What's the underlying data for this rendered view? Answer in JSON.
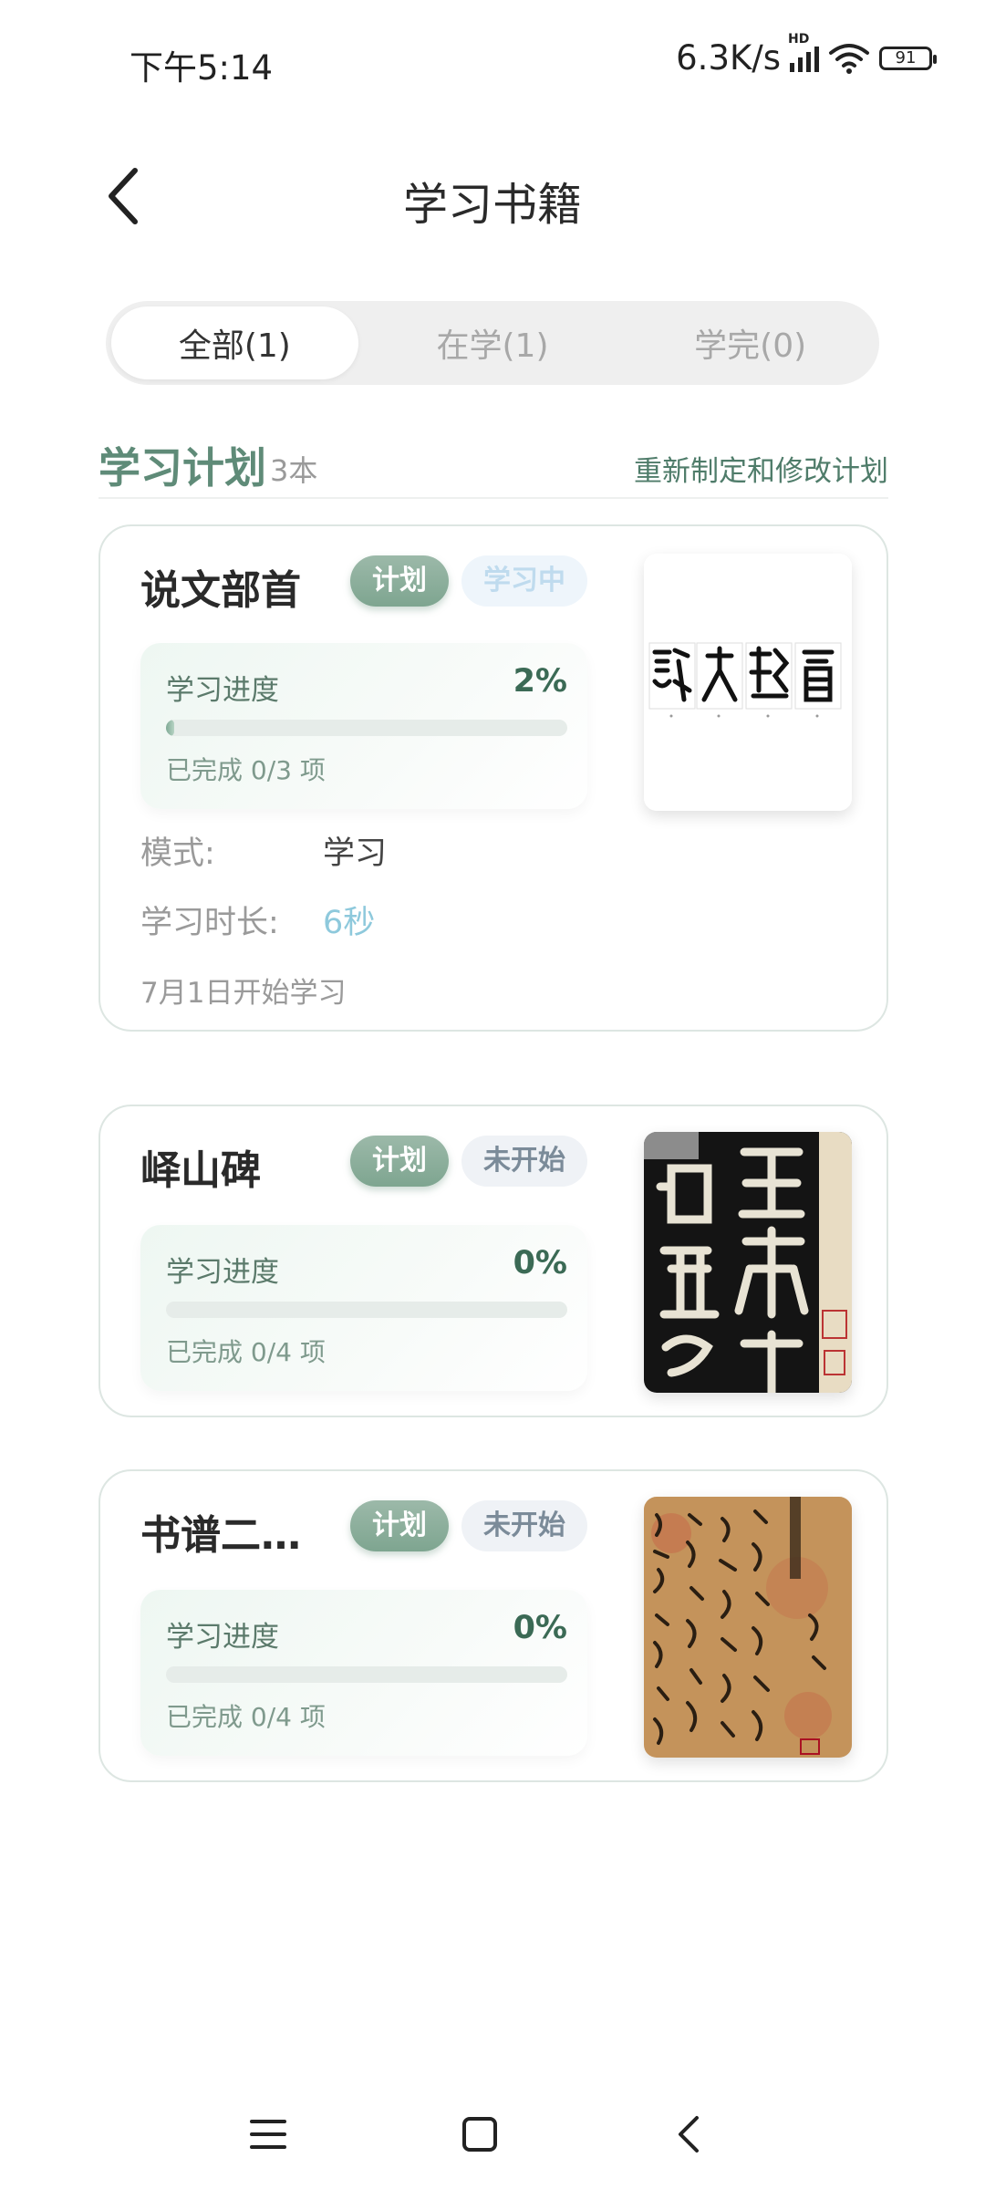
{
  "status": {
    "time": "下午5:14",
    "net_speed": "6.3K/s",
    "signal_badge": "HD",
    "battery": "91"
  },
  "header": {
    "title": "学习书籍",
    "back_icon": "chevron-left-icon"
  },
  "tabs": [
    {
      "label": "全部(1)",
      "active": true
    },
    {
      "label": "在学(1)",
      "active": false
    },
    {
      "label": "学完(0)",
      "active": false
    }
  ],
  "section": {
    "title": "学习计划",
    "count": "3本",
    "link": "重新制定和修改计划"
  },
  "books": [
    {
      "name": "说文部首",
      "tag_plan": "计划",
      "tag_status": "学习中",
      "progress_label": "学习进度",
      "progress_pct": "2%",
      "progress_value": 0.02,
      "done_text": "已完成 0/3 项",
      "mode_label": "模式:",
      "mode_value": "学习",
      "duration_label": "学习时长:",
      "duration_value": "6秒",
      "start_text": "7月1日开始学习"
    },
    {
      "name": "峄山碑",
      "tag_plan": "计划",
      "tag_status": "未开始",
      "progress_label": "学习进度",
      "progress_pct": "0%",
      "progress_value": 0,
      "done_text": "已完成 0/4 项"
    },
    {
      "name": "书谱二…",
      "tag_plan": "计划",
      "tag_status": "未开始",
      "progress_label": "学习进度",
      "progress_pct": "0%",
      "progress_value": 0,
      "done_text": "已完成 0/4 项"
    }
  ],
  "colors": {
    "accent": "#5f8b78",
    "tag_plan": "#8aad9a",
    "duration": "#8ec9dc"
  },
  "navbar": {
    "menu_icon": "menu-icon",
    "home_icon": "home-square-icon",
    "back_icon": "back-triangle-icon"
  }
}
